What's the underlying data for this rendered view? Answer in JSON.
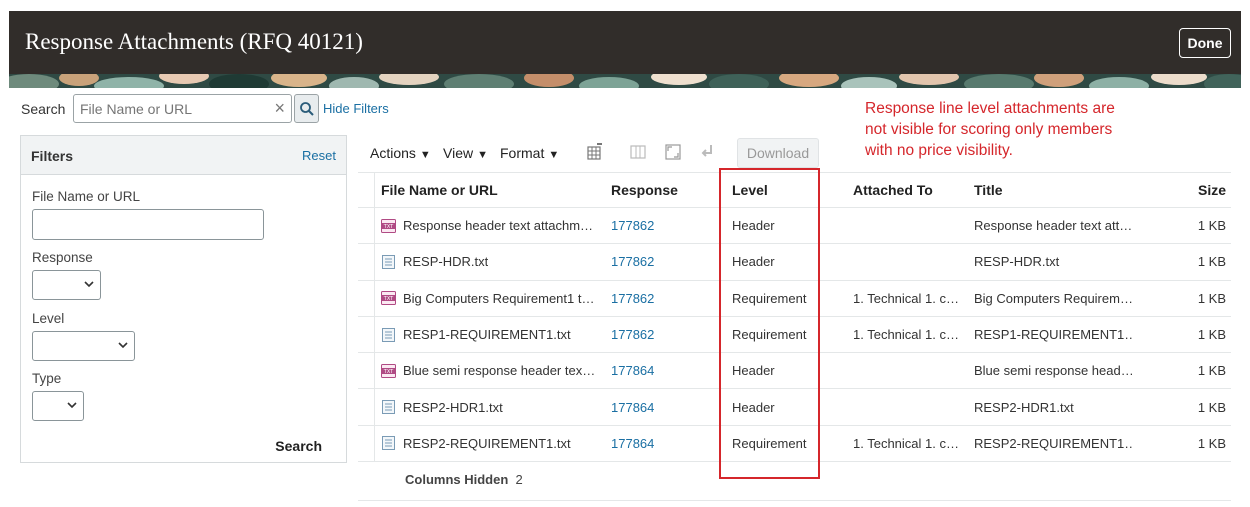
{
  "header": {
    "title": "Response Attachments (RFQ 40121)",
    "done_label": "Done"
  },
  "search": {
    "label": "Search",
    "placeholder": "File Name or URL",
    "hide_filters": "Hide Filters"
  },
  "annotation": "Response line level attachments are not visible for scoring only members with no price visibility.",
  "filters": {
    "title": "Filters",
    "reset": "Reset",
    "file_label": "File Name or URL",
    "response_label": "Response",
    "level_label": "Level",
    "type_label": "Type",
    "search_label": "Search"
  },
  "toolbar": {
    "actions": "Actions",
    "view": "View",
    "format": "Format",
    "download": "Download"
  },
  "table": {
    "headers": {
      "file": "File Name or URL",
      "response": "Response",
      "level": "Level",
      "attached_to": "Attached To",
      "title": "Title",
      "size": "Size"
    },
    "rows": [
      {
        "icon": "text-attachment-icon",
        "file": "Response header text attachm…",
        "response": "177862",
        "level": "Header",
        "attached_to": "",
        "title": "Response header text att…",
        "size": "1 KB"
      },
      {
        "icon": "document-icon",
        "file": "RESP-HDR.txt",
        "response": "177862",
        "level": "Header",
        "attached_to": "",
        "title": "RESP-HDR.txt",
        "size": "1 KB"
      },
      {
        "icon": "text-attachment-icon",
        "file": "Big Computers Requirement1 t…",
        "response": "177862",
        "level": "Requirement",
        "attached_to": "1. Technical 1. c…",
        "title": "Big Computers Requirem…",
        "size": "1 KB"
      },
      {
        "icon": "document-icon",
        "file": "RESP1-REQUIREMENT1.txt",
        "response": "177862",
        "level": "Requirement",
        "attached_to": "1. Technical 1. c…",
        "title": "RESP1-REQUIREMENT1…",
        "size": "1 KB"
      },
      {
        "icon": "text-attachment-icon",
        "file": "Blue semi response header tex…",
        "response": "177864",
        "level": "Header",
        "attached_to": "",
        "title": "Blue semi response head…",
        "size": "1 KB"
      },
      {
        "icon": "document-icon",
        "file": "RESP2-HDR1.txt",
        "response": "177864",
        "level": "Header",
        "attached_to": "",
        "title": "RESP2-HDR1.txt",
        "size": "1 KB"
      },
      {
        "icon": "document-icon",
        "file": "RESP2-REQUIREMENT1.txt",
        "response": "177864",
        "level": "Requirement",
        "attached_to": "1. Technical 1. c…",
        "title": "RESP2-REQUIREMENT1…",
        "size": "1 KB"
      }
    ]
  },
  "columns_hidden": {
    "label": "Columns Hidden",
    "count": "2"
  },
  "colors": {
    "header_bg": "#312d2a",
    "link": "#1a6fa3",
    "annotation": "#d5262b"
  }
}
